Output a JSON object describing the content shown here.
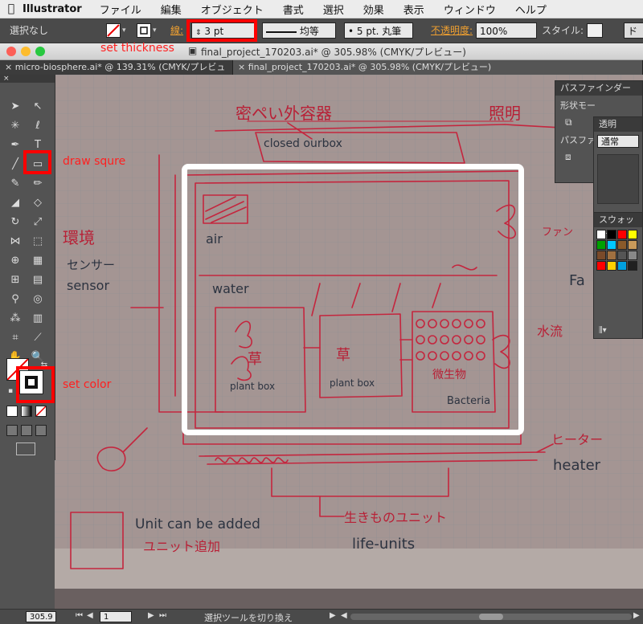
{
  "menubar": {
    "app_name": "Illustrator",
    "items": [
      "ファイル",
      "編集",
      "オブジェクト",
      "書式",
      "選択",
      "効果",
      "表示",
      "ウィンドウ",
      "ヘルプ"
    ]
  },
  "control_bar": {
    "selection_status": "選択なし",
    "stroke_label": "線:",
    "stroke_weight": "3 pt",
    "line_style": "均等",
    "brush": "5 pt. 丸筆",
    "opacity_label": "不透明度:",
    "opacity_value": "100%",
    "style_label": "スタイル:",
    "doc_button": "ド"
  },
  "document": {
    "window_title": "final_project_170203.ai* @ 305.98% (CMYK/プレビュー)",
    "tabs": [
      {
        "label": "micro-biosphere.ai* @ 139.31% (CMYK/プレビュー)"
      },
      {
        "label": "final_project_170203.ai* @ 305.98% (CMYK/プレビュー)"
      }
    ]
  },
  "panels": {
    "pathfinder_title": "パスファインダー",
    "shape_mode": "形状モー",
    "pathfinder_label": "パスファ",
    "transparency_title": "透明",
    "blend_mode": "通常",
    "swatches_title": "スウォッチ"
  },
  "swatch_colors": [
    "#ffffff",
    "#000000",
    "#ff0000",
    "#ffff00",
    "#00a000",
    "#00c8ff",
    "#8a5a2a",
    "#c89a5a",
    "#7a4a2a",
    "#a07040",
    "#555555",
    "#888888",
    "#ff0000",
    "#ffd000",
    "#00a0e0",
    "#202020"
  ],
  "status_bar": {
    "zoom": "305.9",
    "page": "1",
    "tool_hint": "選択ツールを切り換え"
  },
  "annotations": {
    "set_thickness": "set thickness",
    "draw_square": "draw squre",
    "set_color": "set color"
  },
  "sketch_text": {
    "closed_outbox_jp": "密ペい外容器",
    "closed_outbox": "closed ourbox",
    "lighting": "照明",
    "environment_jp": "環境",
    "sensor_jp": "センサー",
    "sensor": "sensor",
    "air": "air",
    "water": "water",
    "fan_jp": "ファン",
    "fan": "Fa",
    "pump_jp": "水流",
    "plant_jp": "草",
    "plant_box_1": "plant box",
    "plant_box_2": "plant box",
    "bacteria_jp": "微生物",
    "bacteria": "Bacteria",
    "heater_jp": "ヒーター",
    "heater": "heater",
    "unit_added": "Unit can be added",
    "unit_added_jp": "ユニット追加",
    "life_units_jp": "生きものユニット",
    "life_units": "life-units"
  }
}
